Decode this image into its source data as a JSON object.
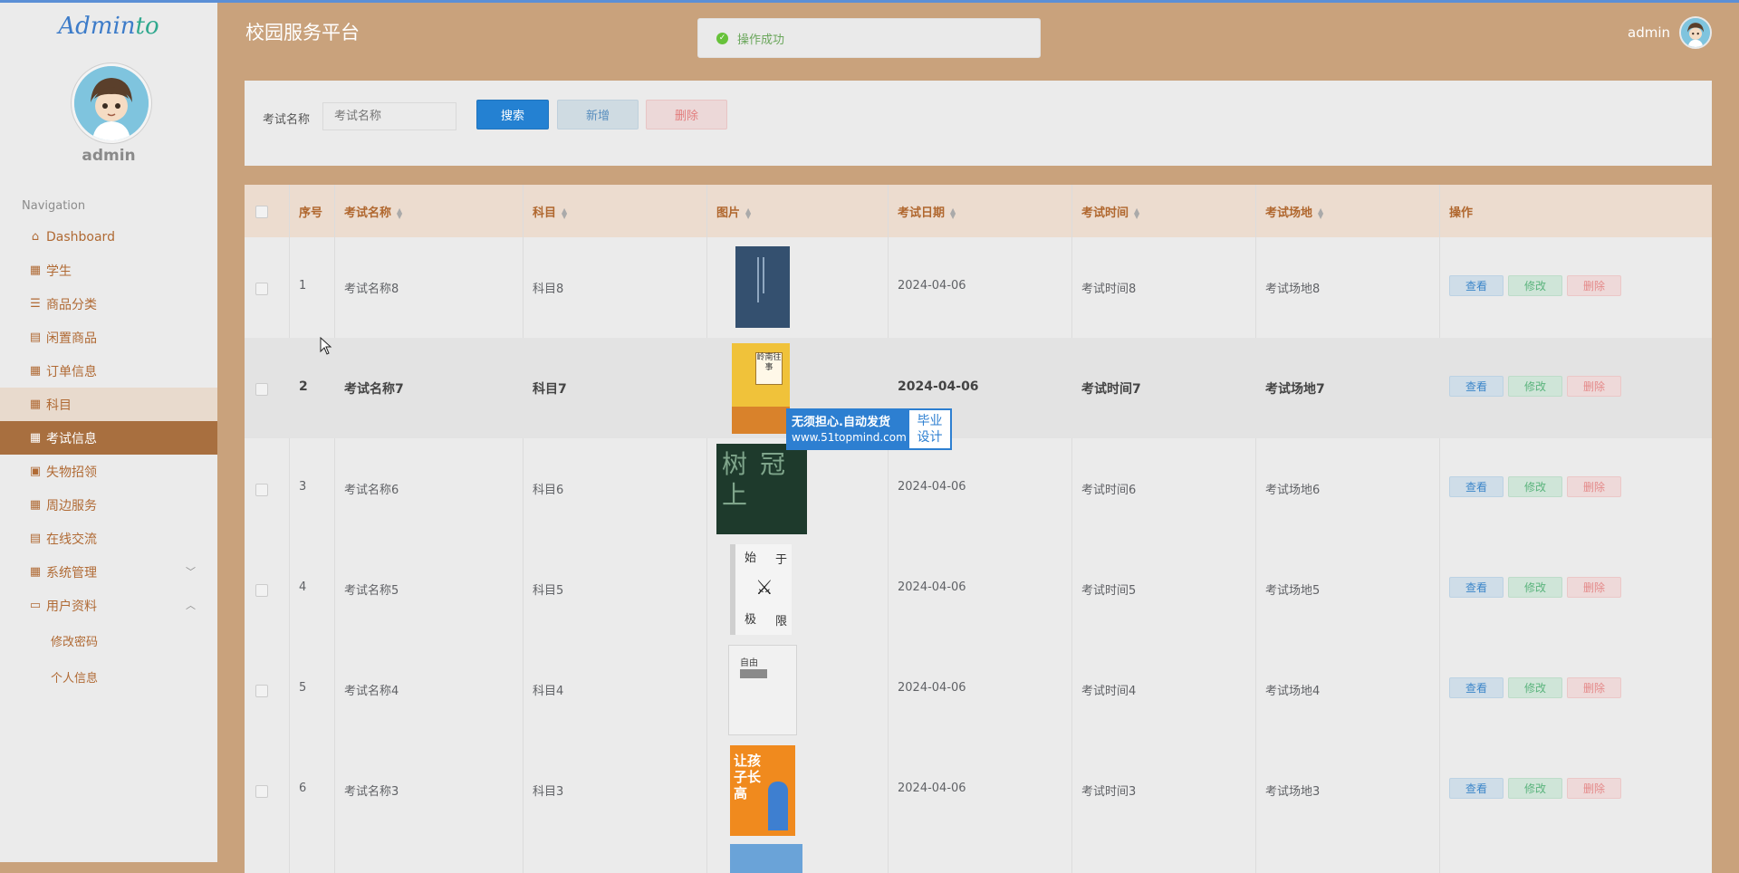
{
  "sidebar": {
    "logo_main": "Admin",
    "logo_accent": "to",
    "user_name": "admin",
    "nav_caption": "Navigation",
    "items": [
      {
        "label": "Dashboard",
        "icon": "home-icon"
      },
      {
        "label": "学生",
        "icon": "grid-icon"
      },
      {
        "label": "商品分类",
        "icon": "list-icon"
      },
      {
        "label": "闲置商品",
        "icon": "clipboard-icon"
      },
      {
        "label": "订单信息",
        "icon": "grid-icon"
      },
      {
        "label": "科目",
        "icon": "grid-icon"
      },
      {
        "label": "考试信息",
        "icon": "grid-icon"
      },
      {
        "label": "失物招领",
        "icon": "briefcase-icon"
      },
      {
        "label": "周边服务",
        "icon": "grid-icon"
      },
      {
        "label": "在线交流",
        "icon": "clipboard-icon"
      },
      {
        "label": "系统管理",
        "icon": "grid-icon"
      },
      {
        "label": "用户资料",
        "icon": "card-icon"
      }
    ],
    "sub_items": [
      "修改密码",
      "个人信息"
    ]
  },
  "header": {
    "title": "校园服务平台",
    "user": "admin",
    "toast": "操作成功"
  },
  "search": {
    "label": "考试名称",
    "placeholder": "考试名称",
    "search_btn": "搜索",
    "add_btn": "新增",
    "delete_btn": "删除"
  },
  "table": {
    "headers": [
      "序号",
      "考试名称",
      "科目",
      "图片",
      "考试日期",
      "考试时间",
      "考试场地",
      "操作"
    ],
    "rows": [
      {
        "no": "1",
        "name": "考试名称8",
        "subject": "科目8",
        "date": "2024-04-06",
        "time": "考试时间8",
        "place": "考试场地8"
      },
      {
        "no": "2",
        "name": "考试名称7",
        "subject": "科目7",
        "date": "2024-04-06",
        "time": "考试时间7",
        "place": "考试场地7"
      },
      {
        "no": "3",
        "name": "考试名称6",
        "subject": "科目6",
        "date": "2024-04-06",
        "time": "考试时间6",
        "place": "考试场地6"
      },
      {
        "no": "4",
        "name": "考试名称5",
        "subject": "科目5",
        "date": "2024-04-06",
        "time": "考试时间5",
        "place": "考试场地5"
      },
      {
        "no": "5",
        "name": "考试名称4",
        "subject": "科目4",
        "date": "2024-04-06",
        "time": "考试时间4",
        "place": "考试场地4"
      },
      {
        "no": "6",
        "name": "考试名称3",
        "subject": "科目3",
        "date": "2024-04-06",
        "time": "考试时间3",
        "place": "考试场地3"
      }
    ],
    "actions": {
      "view": "查看",
      "edit": "修改",
      "delete": "删除"
    }
  },
  "covers": {
    "row2_title": "岭南往事",
    "row3_title": "树冠上",
    "row4_title": [
      "始",
      "于",
      "极",
      "限"
    ],
    "row5_title": "自由",
    "row6_title": "让孩子长高"
  },
  "watermark": {
    "line1": "无须担心.自动发货",
    "line2": "www.51topmind.com",
    "right1": "毕业",
    "right2": "设计"
  },
  "colors": {
    "sidebar_bg": "#ebebeb",
    "main_bg": "#c9a27c",
    "active_menu": "#a86f3f",
    "accent_text": "#b06a34",
    "primary_button": "#2481d2"
  }
}
